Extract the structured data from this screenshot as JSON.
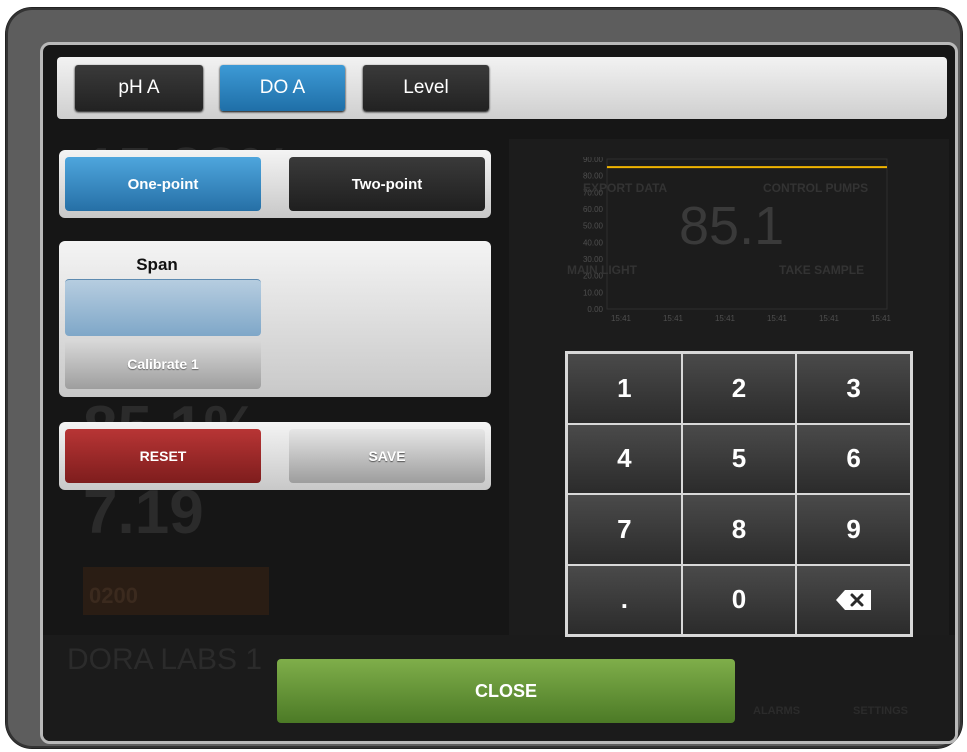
{
  "tabs": [
    {
      "label": "pH A",
      "active": false
    },
    {
      "label": "DO A",
      "active": true
    },
    {
      "label": "Level",
      "active": false
    }
  ],
  "mode": {
    "one_point_label": "One-point",
    "two_point_label": "Two-point",
    "selected": "One-point"
  },
  "calibration": {
    "span_label": "Span",
    "span_value": "",
    "calibrate_label": "Calibrate 1"
  },
  "actions": {
    "reset_label": "RESET",
    "save_label": "SAVE",
    "close_label": "CLOSE"
  },
  "keypad": {
    "keys": [
      "1",
      "2",
      "3",
      "4",
      "5",
      "6",
      "7",
      "8",
      "9",
      ".",
      "0"
    ],
    "backspace_icon": "backspace-icon"
  },
  "background": {
    "reading_top": "15.33%",
    "reading_mid": "85.1%",
    "reading_low": "7.19",
    "chart_value": "85.1",
    "export_label": "EXPORT DATA",
    "control_label": "CONTROL PUMPS",
    "main_light_label": "MAIN LIGHT",
    "take_sample_label": "TAKE SAMPLE",
    "device_name": "DORA LABS 1",
    "orange_value": "0200",
    "alarms_label": "ALARMS",
    "settings_label": "SETTINGS"
  },
  "chart_data": {
    "type": "line",
    "x": [
      "15:41",
      "15:41",
      "15:41",
      "15:41",
      "15:41",
      "15:41"
    ],
    "y_ticks": [
      "0.00",
      "10.00",
      "20.00",
      "30.00",
      "40.00",
      "50.00",
      "60.00",
      "70.00",
      "80.00",
      "90.00"
    ],
    "ylim": [
      0,
      90
    ],
    "series": [
      {
        "values": [
          85.1,
          85.1,
          85.1,
          85.1,
          85.1,
          85.1
        ],
        "color": "#f0b400"
      }
    ]
  },
  "colors": {
    "accent_blue": "#2f86c3",
    "reset_red": "#9b2727",
    "close_green": "#5f8f33"
  }
}
